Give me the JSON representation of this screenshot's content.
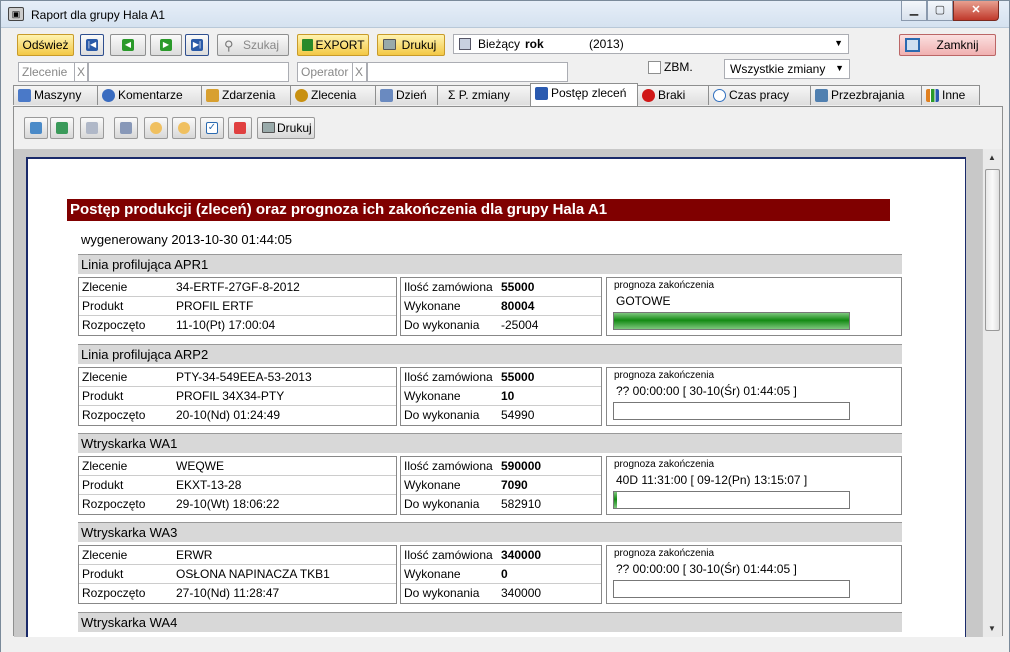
{
  "window": {
    "title": "Raport dla grupy  Hala A1",
    "minimize": "▁",
    "maximize": "▢",
    "close": "✕"
  },
  "toolbar": {
    "refresh": "Odśwież",
    "search": "Szukaj",
    "export": "EXPORT",
    "print": "Drukuj",
    "year_label": "Bieżący",
    "year_bold": "rok",
    "year_value": "(2013)",
    "close_window": "Zamknij"
  },
  "filters": {
    "order_label": "Zlecenie",
    "order_clear": "X",
    "order_value": "",
    "operator_label": "Operator",
    "operator_clear": "X",
    "operator_value": "",
    "zbm_label": "ZBM.",
    "shifts_value": "Wszystkie zmiany"
  },
  "tabs": [
    {
      "label": "Maszyny",
      "color": "#4a79c8"
    },
    {
      "label": "Komentarze",
      "color": "#3a6cc0"
    },
    {
      "label": "Zdarzenia",
      "color": "#d8a030"
    },
    {
      "label": "Zlecenia",
      "color": "#c89010"
    },
    {
      "label": "Dzień",
      "color": "#6a8ac0"
    },
    {
      "label": "Σ  P. zmiany",
      "color": ""
    },
    {
      "label": "Postęp zleceń",
      "color": "#2a5ab0"
    },
    {
      "label": "Braki",
      "color": "#d01818"
    },
    {
      "label": "Czas pracy",
      "color": "#3070c0"
    },
    {
      "label": "Przezbrajania",
      "color": "#5080b0"
    },
    {
      "label": "Inne",
      "color": "#e08020"
    }
  ],
  "report_toolbar": {
    "print": "Drukuj"
  },
  "report": {
    "title": "Postęp produkcji (zleceń) oraz prognoza ich zakończenia dla grupy Hala A1",
    "generated": "wygenerowany 2013-10-30 01:44:05",
    "labels": {
      "order": "Zlecenie",
      "product": "Produkt",
      "started": "Rozpoczęto",
      "ordered": "Ilość zamówiona",
      "done": "Wykonane",
      "todo": "Do wykonania",
      "forecast": "prognoza zakończenia"
    },
    "sections": [
      {
        "name": "Linia profilująca APR1",
        "order": "34-ERTF-27GF-8-2012",
        "product": "PROFIL ERTF",
        "started": "11-10(Pt) 17:00:04",
        "ordered": "55000",
        "done": "80004",
        "todo": "-25004",
        "forecast": "GOTOWE",
        "progress": 1.0
      },
      {
        "name": "Linia profilująca ARP2",
        "order": "PTY-34-549EEA-53-2013",
        "product": "PROFIL 34X34-PTY",
        "started": "20-10(Nd) 01:24:49",
        "ordered": "55000",
        "done": "10",
        "todo": "54990",
        "forecast": "?? 00:00:00  [ 30-10(Śr) 01:44:05 ]",
        "progress": 0.0
      },
      {
        "name": "Wtryskarka WA1",
        "order": "WEQWE",
        "product": "EKXT-13-28",
        "started": "29-10(Wt) 18:06:22",
        "ordered": "590000",
        "done": "7090",
        "todo": "582910",
        "forecast": "40D 11:31:00  [ 09-12(Pn) 13:15:07 ]",
        "progress": 0.012
      },
      {
        "name": "Wtryskarka WA3",
        "order": "ERWR",
        "product": "OSŁONA NAPINACZA TKB1",
        "started": "27-10(Nd) 11:28:47",
        "ordered": "340000",
        "done": "0",
        "todo": "340000",
        "forecast": "?? 00:00:00  [ 30-10(Śr) 01:44:05 ]",
        "progress": 0.0
      },
      {
        "name": "Wtryskarka WA4"
      }
    ]
  }
}
